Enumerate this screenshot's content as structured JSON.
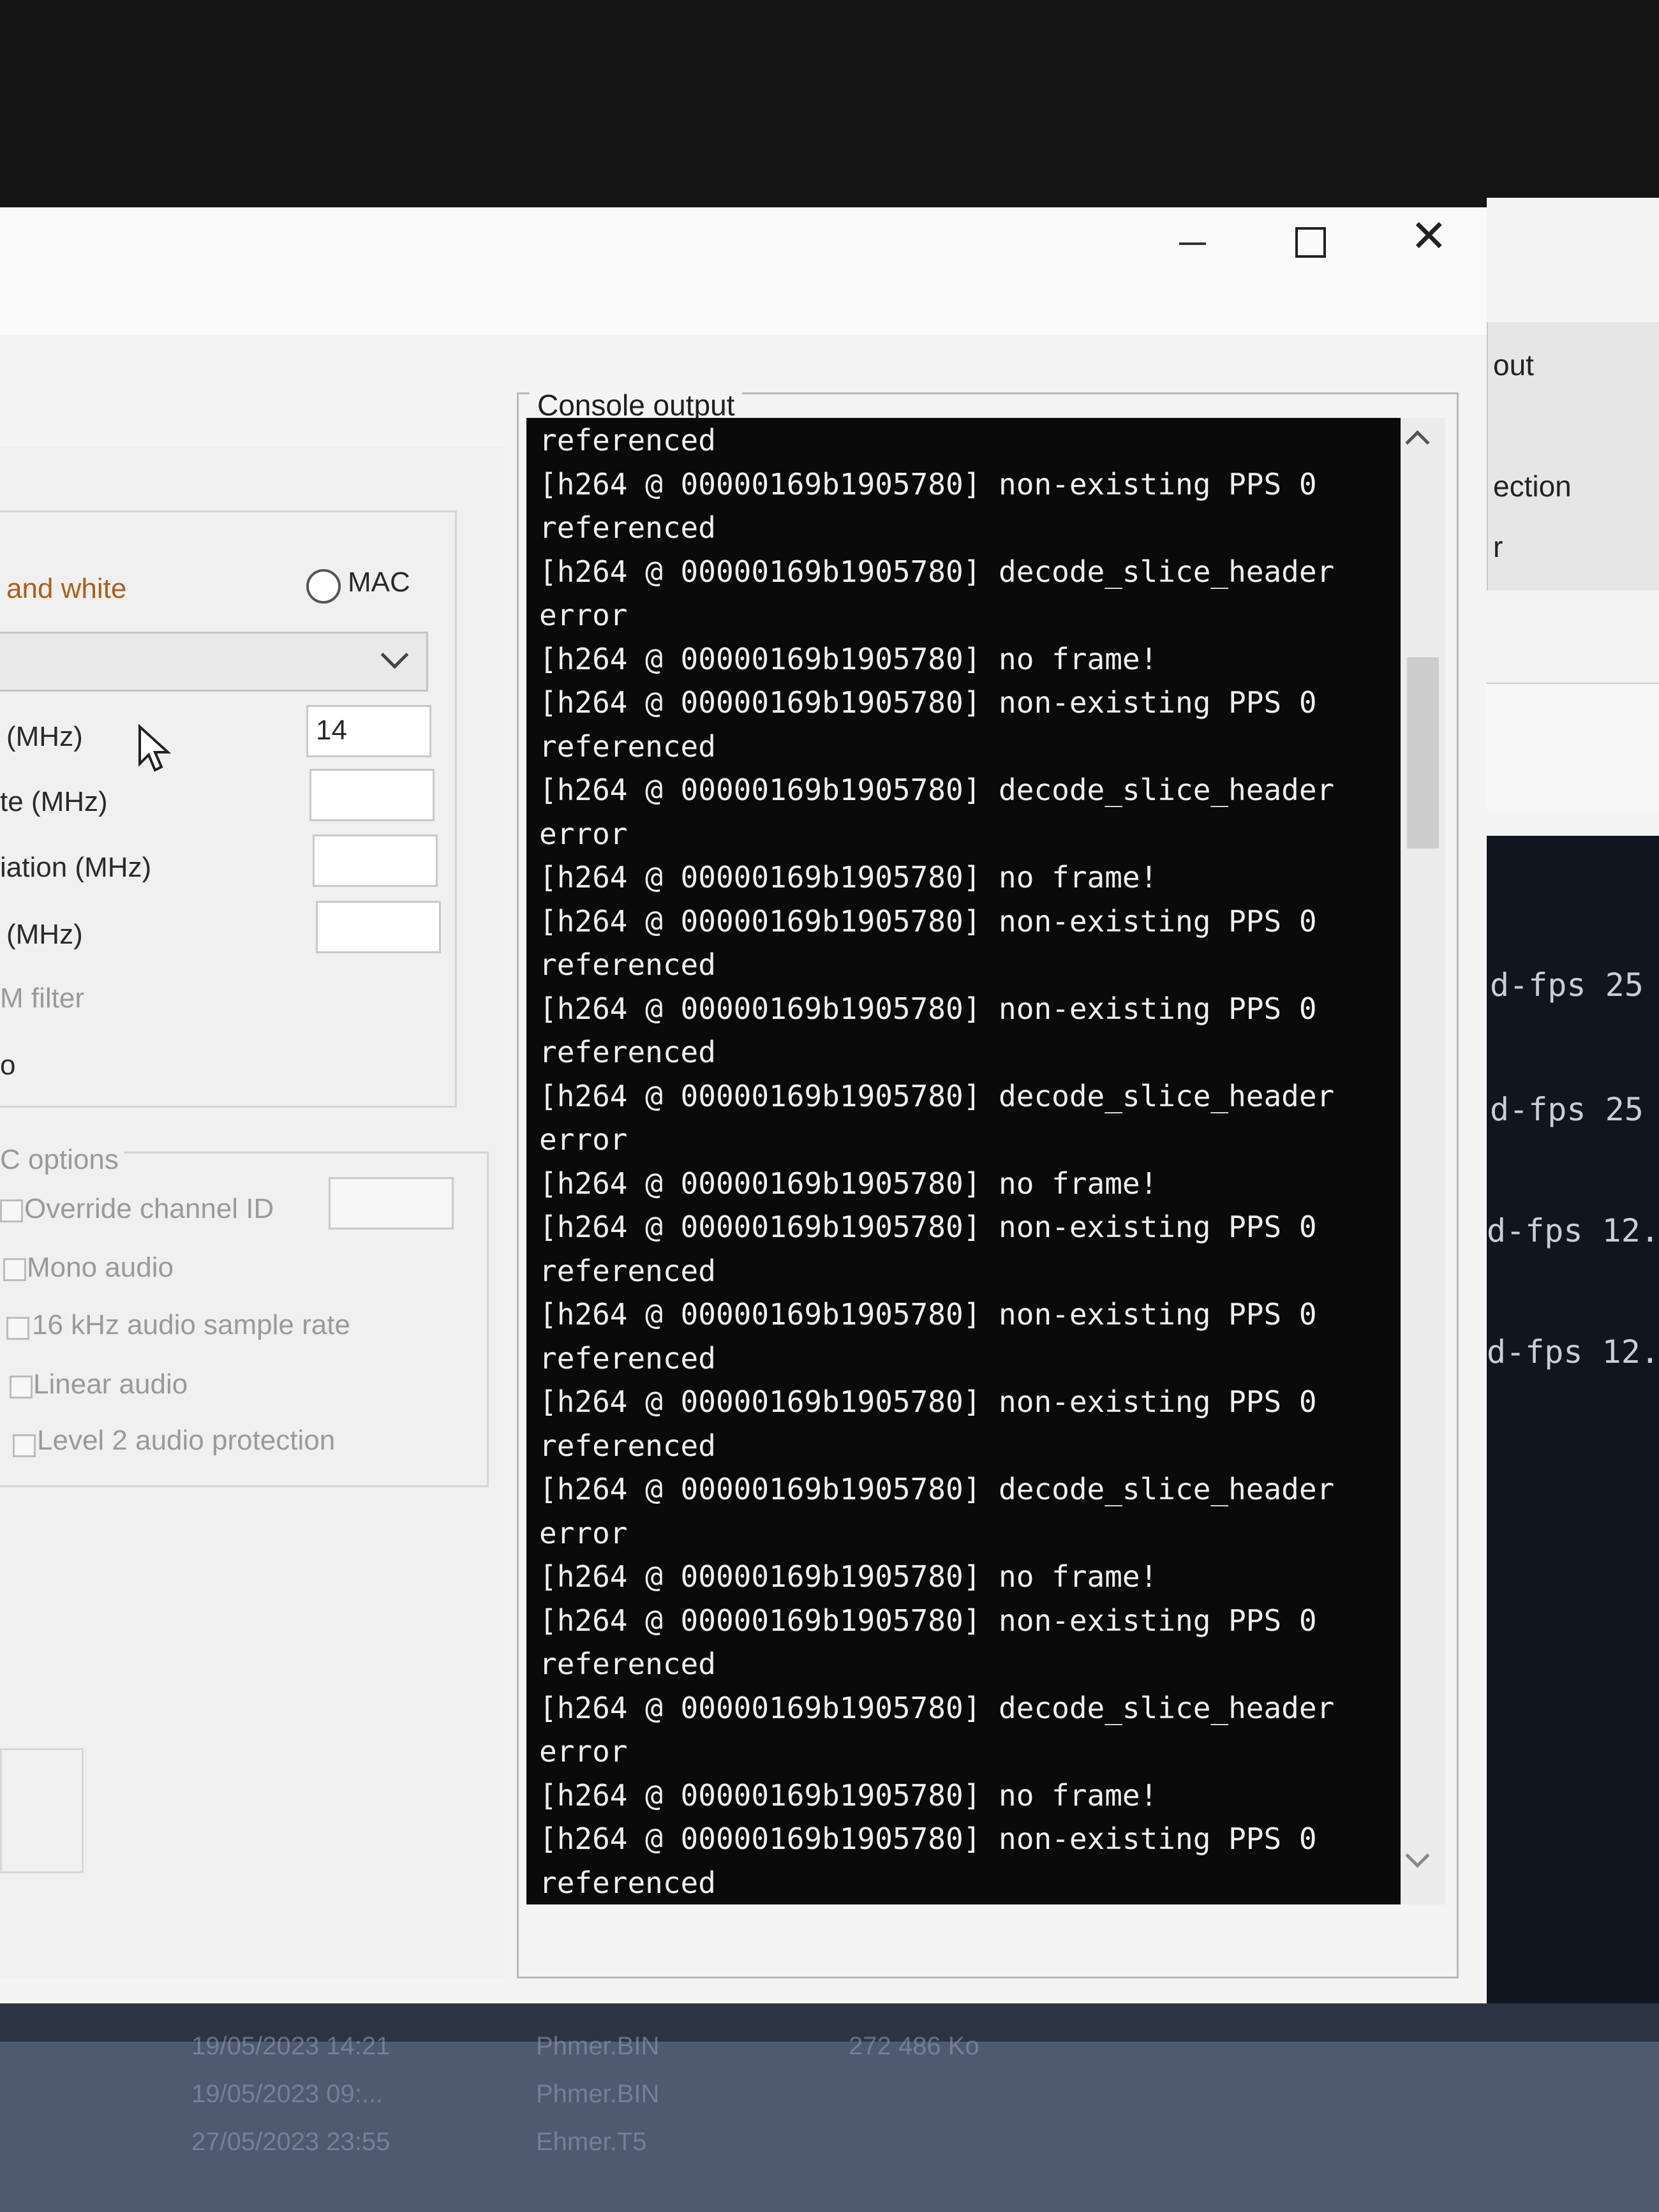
{
  "window": {
    "minimize_icon": "minimize-icon",
    "maximize_icon": "maximize-icon",
    "close_icon": "close-icon"
  },
  "left_panel": {
    "radio_color_label": "and white",
    "radio_mac_label": "MAC",
    "fields": [
      {
        "label": "(MHz)",
        "value": "14"
      },
      {
        "label": "te (MHz)",
        "value": ""
      },
      {
        "label": "iation (MHz)",
        "value": ""
      },
      {
        "label": "(MHz)",
        "value": ""
      }
    ],
    "filter_label": "M filter",
    "extra_label": "o",
    "mac_options": {
      "legend": "C options",
      "items": [
        "Override channel ID",
        "Mono audio",
        "16 kHz audio sample rate",
        "Linear audio",
        "Level 2 audio protection"
      ]
    }
  },
  "console": {
    "title": "Console output",
    "lines": [
      "referenced",
      "[h264 @ 00000169b1905780] non-existing PPS 0",
      "referenced",
      "[h264 @ 00000169b1905780] decode_slice_header",
      "error",
      "[h264 @ 00000169b1905780] no frame!",
      "[h264 @ 00000169b1905780] non-existing PPS 0",
      "referenced",
      "[h264 @ 00000169b1905780] decode_slice_header",
      "error",
      "[h264 @ 00000169b1905780] no frame!",
      "[h264 @ 00000169b1905780] non-existing PPS 0",
      "referenced",
      "[h264 @ 00000169b1905780] non-existing PPS 0",
      "referenced",
      "[h264 @ 00000169b1905780] decode_slice_header",
      "error",
      "[h264 @ 00000169b1905780] no frame!",
      "[h264 @ 00000169b1905780] non-existing PPS 0",
      "referenced",
      "[h264 @ 00000169b1905780] non-existing PPS 0",
      "referenced",
      "[h264 @ 00000169b1905780] non-existing PPS 0",
      "referenced",
      "[h264 @ 00000169b1905780] decode_slice_header",
      "error",
      "[h264 @ 00000169b1905780] no frame!",
      "[h264 @ 00000169b1905780] non-existing PPS 0",
      "referenced",
      "[h264 @ 00000169b1905780] decode_slice_header",
      "error",
      "[h264 @ 00000169b1905780] no frame!",
      "[h264 @ 00000169b1905780] non-existing PPS 0",
      "referenced"
    ]
  },
  "background_window": {
    "label_top": "out",
    "label_mid": "ection",
    "label_small": "r",
    "terminal_lines": [
      "d-fps 25",
      "d-fps 25",
      "d-fps 12.",
      "d-fps 12."
    ]
  },
  "desktop": {
    "row1_date": "19/05/2023 14:21",
    "row1_name": "Phmer.BIN",
    "row1_size": "272 486 Ko",
    "row2_date": "19/05/2023 09:...",
    "row2_name": "Phmer.BIN",
    "row3_date": "27/05/2023 23:55",
    "row3_name": "Ehmer.T5"
  }
}
